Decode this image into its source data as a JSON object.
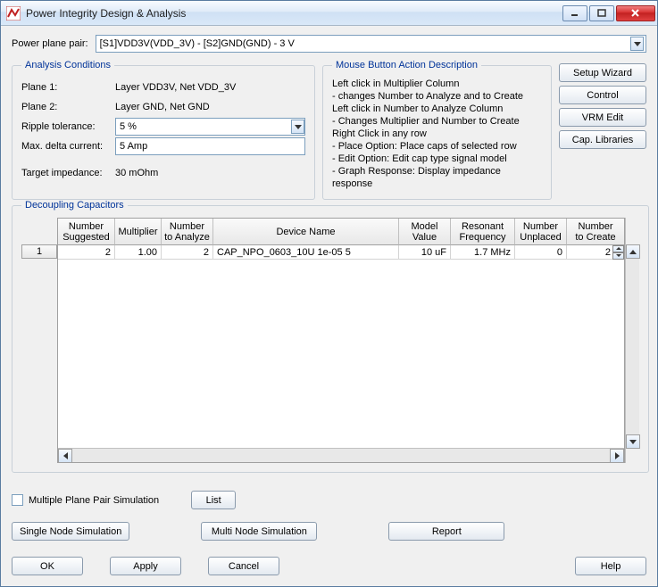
{
  "window": {
    "title": "Power Integrity Design & Analysis"
  },
  "powerPlanePair": {
    "label": "Power plane pair:",
    "value": "[S1]VDD3V(VDD_3V) - [S2]GND(GND) - 3 V"
  },
  "analysis": {
    "legend": "Analysis Conditions",
    "plane1_label": "Plane 1:",
    "plane1_value": "Layer VDD3V, Net VDD_3V",
    "plane2_label": "Plane 2:",
    "plane2_value": "Layer GND, Net GND",
    "ripple_label": "Ripple tolerance:",
    "ripple_value": "5 %",
    "maxdelta_label": "Max. delta current:",
    "maxdelta_value": "5 Amp",
    "target_label": "Target impedance:",
    "target_value": "30 mOhm"
  },
  "mouse": {
    "legend": "Mouse Button Action Description",
    "lines": {
      "l0": "Left click in Multiplier Column",
      "l1": "- changes Number to Analyze and to Create",
      "l2": "Left click in Number to Analyze Column",
      "l3": "- Changes Multiplier and Number to Create",
      "l4": "Right Click in any row",
      "l5": "- Place Option: Place caps of selected row",
      "l6": "- Edit Option: Edit cap type signal model",
      "l7": "- Graph Response: Display impedance response"
    }
  },
  "sideButtons": {
    "setup": "Setup Wizard",
    "control": "Control",
    "vrm": "VRM Edit",
    "cap": "Cap. Libraries"
  },
  "decap": {
    "legend": "Decoupling Capacitors",
    "headers": {
      "suggested": "Number\nSuggested",
      "multiplier": "Multiplier",
      "analyze": "Number\nto Analyze",
      "device": "Device Name",
      "value": "Model\nValue",
      "freq": "Resonant\nFrequency",
      "unplaced": "Number\nUnplaced",
      "create": "Number\nto Create"
    },
    "rowIndex": "1",
    "row": {
      "suggested": "2",
      "multiplier": "1.00",
      "analyze": "2",
      "device": "CAP_NPO_0603_10U 1e-05 5",
      "value": "10 uF",
      "freq": "1.7 MHz",
      "unplaced": "0",
      "create": "2"
    }
  },
  "lower": {
    "multi_sim_label": "Multiple Plane Pair Simulation",
    "list": "List",
    "single": "Single Node Simulation",
    "multi": "Multi Node Simulation",
    "report": "Report"
  },
  "bottom": {
    "ok": "OK",
    "apply": "Apply",
    "cancel": "Cancel",
    "help": "Help"
  }
}
